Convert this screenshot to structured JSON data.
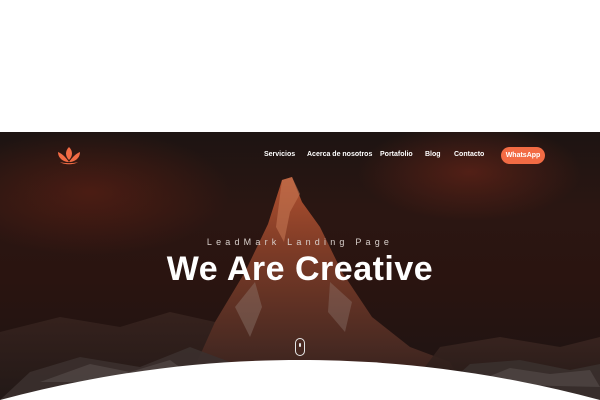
{
  "nav": {
    "items": [
      {
        "label": "Servicios"
      },
      {
        "label": "Acerca de nosotros"
      },
      {
        "label": "Portafolio"
      },
      {
        "label": "Blog"
      },
      {
        "label": "Contacto"
      }
    ],
    "cta_label": "WhatsApp"
  },
  "hero": {
    "tagline": "LeadMark Landing Page",
    "headline": "We Are Creative"
  },
  "colors": {
    "accent": "#f26b44",
    "hero_background": "#2a1612",
    "text_light": "#ffffff"
  },
  "icons": {
    "logo": "lotus-logo-icon",
    "scroll": "mouse-scroll-icon"
  }
}
